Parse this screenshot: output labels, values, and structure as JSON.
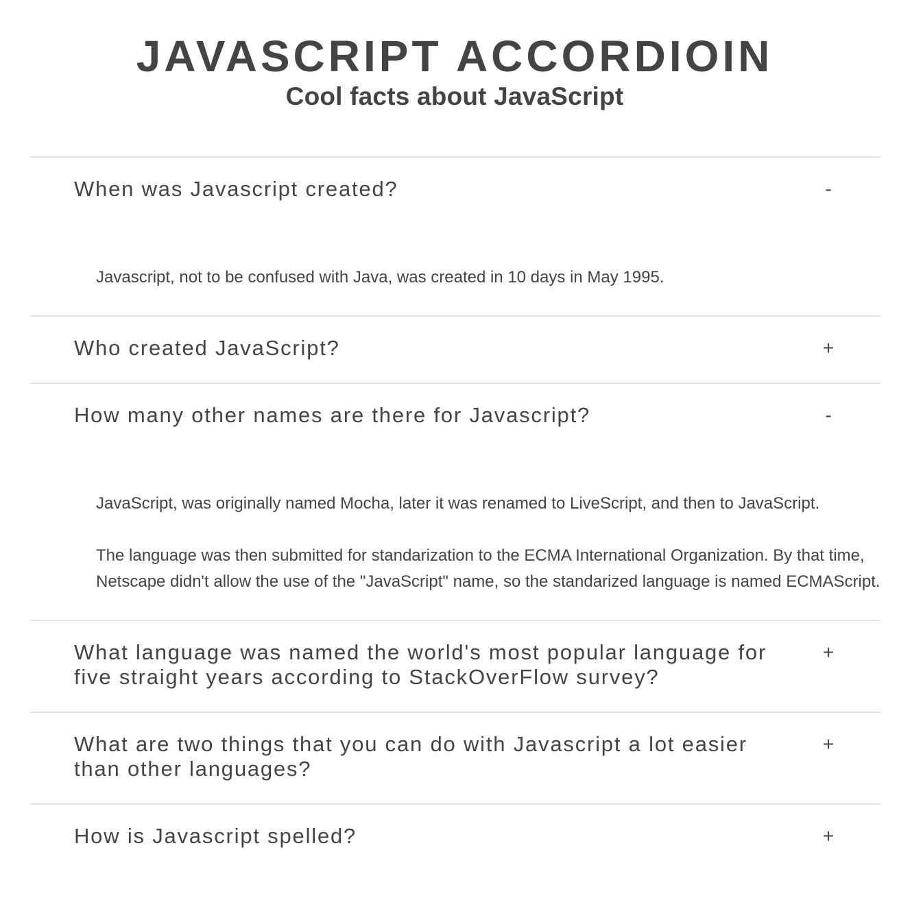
{
  "header": {
    "title": "JAVASCRIPT ACCORDIOIN",
    "subtitle": "Cool facts about JavaScript"
  },
  "accordion": {
    "items": [
      {
        "question": "When was Javascript created?",
        "toggle": "-",
        "expanded": true,
        "answers": [
          "Javascript, not to be confused with Java, was created in 10 days in May 1995."
        ]
      },
      {
        "question": "Who created JavaScript?",
        "toggle": "+",
        "expanded": false,
        "answers": []
      },
      {
        "question": "How many other names are there for Javascript?",
        "toggle": "-",
        "expanded": true,
        "answers": [
          "JavaScript, was originally named Mocha, later it was renamed to LiveScript, and then to JavaScript.",
          "The language was then submitted for standarization to the ECMA International Organization. By that time, Netscape didn't allow the use of the \"JavaScript\" name, so the standarized language is named ECMAScript."
        ]
      },
      {
        "question": "What language was named the world's most popular language for five straight years according to StackOverFlow survey?",
        "toggle": "+",
        "expanded": false,
        "answers": []
      },
      {
        "question": "What are two things that you can do with Javascript a lot easier than other languages?",
        "toggle": "+",
        "expanded": false,
        "answers": []
      },
      {
        "question": "How is Javascript spelled?",
        "toggle": "+",
        "expanded": false,
        "answers": []
      }
    ]
  }
}
